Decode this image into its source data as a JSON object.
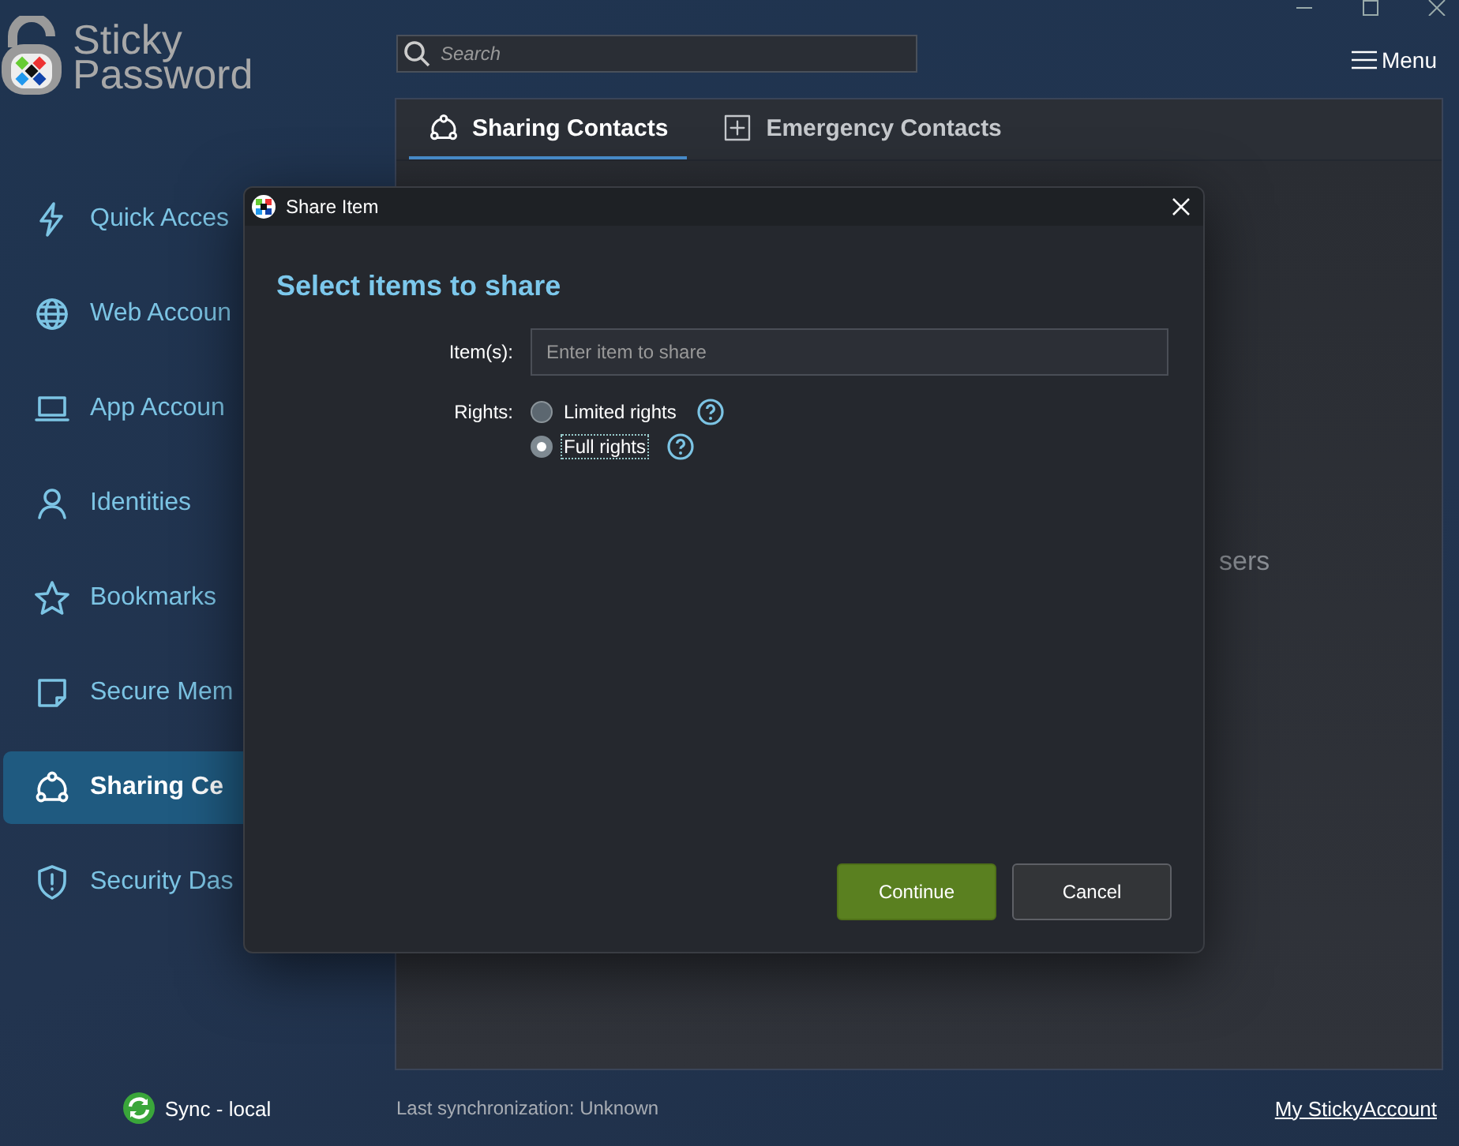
{
  "logo": {
    "line1": "Sticky",
    "line2": "Password"
  },
  "search": {
    "placeholder": "Search"
  },
  "menu": {
    "label": "Menu"
  },
  "sidebar": {
    "items": [
      {
        "label": "Quick Acces",
        "kind": "bolt",
        "selected": false
      },
      {
        "label": "Web Accoun",
        "kind": "globe",
        "selected": false
      },
      {
        "label": "App Accoun",
        "kind": "laptop",
        "selected": false
      },
      {
        "label": "Identities",
        "kind": "user",
        "selected": false
      },
      {
        "label": "Bookmarks",
        "kind": "star",
        "selected": false
      },
      {
        "label": "Secure Mem",
        "kind": "note",
        "selected": false
      },
      {
        "label": "Sharing Ce",
        "kind": "share",
        "selected": true
      },
      {
        "label": "Security Das",
        "kind": "shield",
        "selected": false
      }
    ]
  },
  "tabs": [
    {
      "label": "Sharing Contacts",
      "kind": "share",
      "selected": true
    },
    {
      "label": "Emergency Contacts",
      "kind": "plus",
      "selected": false
    }
  ],
  "panel_text": "sers",
  "status": {
    "sync": "Sync - local",
    "last_sync": "Last synchronization: Unknown",
    "account_link": "My StickyAccount"
  },
  "dialog": {
    "title": "Share Item",
    "heading": "Select items to share",
    "items_label": "Item(s):",
    "items_placeholder": "Enter item to share",
    "rights_label": "Rights:",
    "rights": [
      {
        "label": "Limited rights",
        "selected": false
      },
      {
        "label": "Full rights",
        "selected": true
      }
    ],
    "buttons": [
      {
        "label": "Continue",
        "kind": "primary"
      },
      {
        "label": "Cancel",
        "kind": "secondary"
      }
    ]
  }
}
